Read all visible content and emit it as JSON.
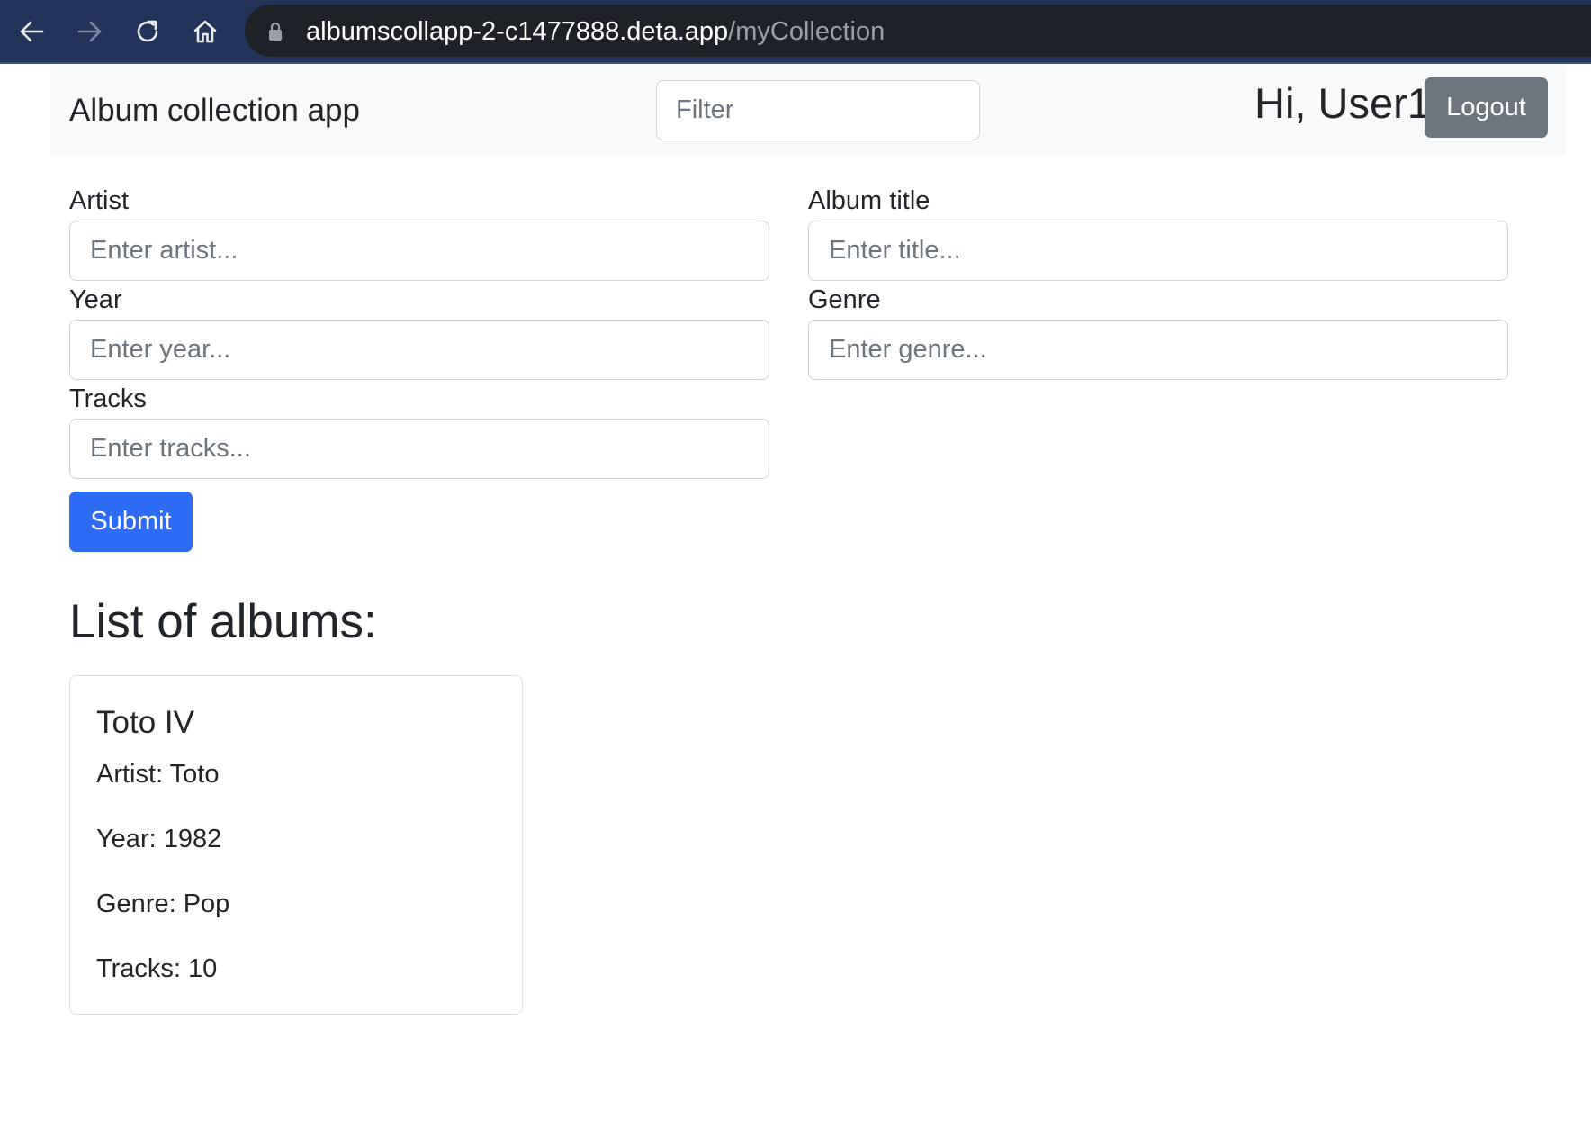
{
  "browser": {
    "url_host": "albumscollapp-2-c1477888.deta.app",
    "url_path": "/myCollection",
    "icons": [
      "back-arrow-icon",
      "forward-arrow-icon",
      "reload-icon",
      "home-icon",
      "lock-icon"
    ],
    "colors": {
      "toolbar": "#22345a",
      "url_field": "#1e2127"
    }
  },
  "navbar": {
    "brand": "Album collection app",
    "filter_placeholder": "Filter",
    "greeting": "Hi, User1",
    "logout_label": "Logout",
    "colors": {
      "background": "#f8f9fa",
      "logout": "#6c757d"
    }
  },
  "form": {
    "artist": {
      "label": "Artist",
      "placeholder": "Enter artist...",
      "value": ""
    },
    "album_title": {
      "label": "Album title",
      "placeholder": "Enter title...",
      "value": ""
    },
    "year": {
      "label": "Year",
      "placeholder": "Enter year...",
      "value": ""
    },
    "genre": {
      "label": "Genre",
      "placeholder": "Enter genre...",
      "value": ""
    },
    "tracks": {
      "label": "Tracks",
      "placeholder": "Enter tracks...",
      "value": ""
    },
    "submit_label": "Submit",
    "colors": {
      "submit": "#2f6cf6"
    }
  },
  "albums": {
    "heading": "List of albums:",
    "items": [
      {
        "title": "Toto IV",
        "artist": "Artist: Toto",
        "year": "Year: 1982",
        "genre": "Genre: Pop",
        "tracks": "Tracks: 10"
      }
    ]
  }
}
